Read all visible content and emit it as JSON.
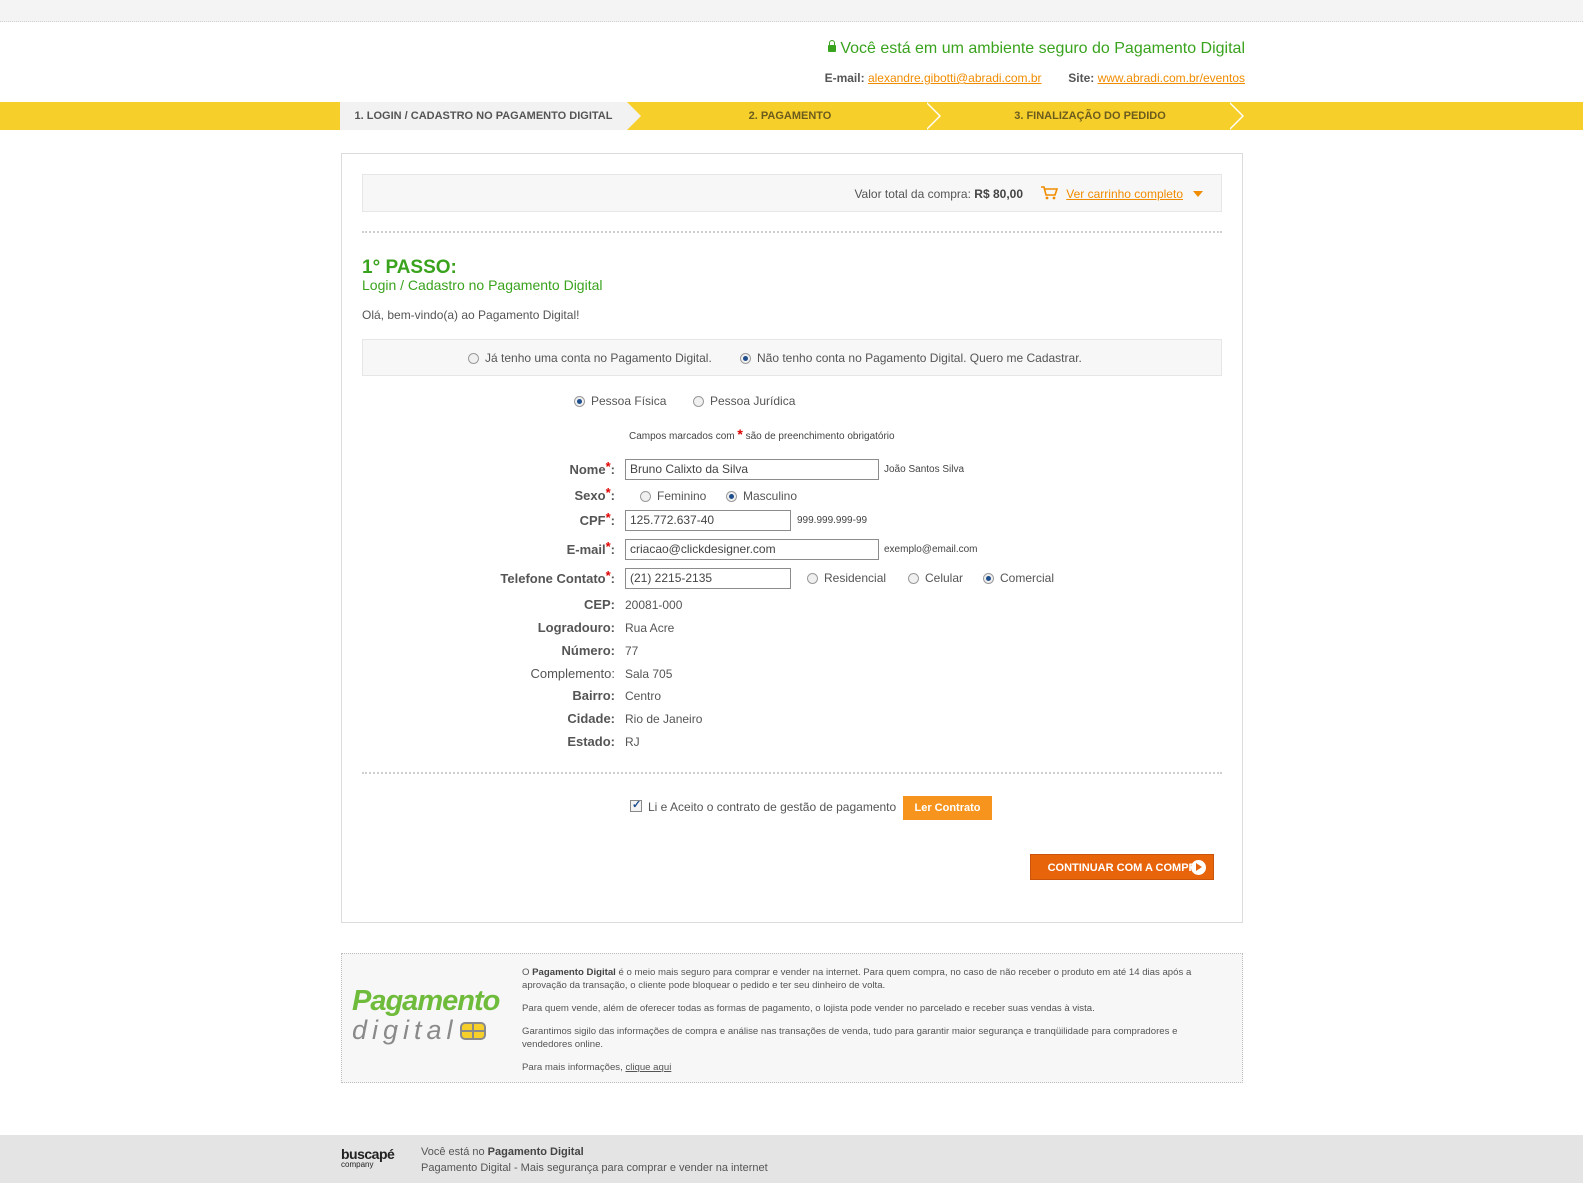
{
  "header": {
    "secure_text": "Você está em um ambiente seguro do Pagamento Digital",
    "email_label": "E-mail:",
    "email_value": "alexandre.gibotti@abradi.com.br",
    "site_label": "Site:",
    "site_value": "www.abradi.com.br/eventos"
  },
  "steps": [
    {
      "label": "1. LOGIN / CADASTRO NO PAGAMENTO DIGITAL"
    },
    {
      "label": "2. PAGAMENTO"
    },
    {
      "label": "3. FINALIZAÇÃO DO PEDIDO"
    }
  ],
  "cart": {
    "total_label": "Valor total da compra:",
    "total_value": "R$ 80,00",
    "link": "Ver carrinho completo"
  },
  "passo": {
    "title": "1° PASSO:",
    "subtitle": "Login / Cadastro no Pagamento Digital",
    "welcome": "Olá, bem-vindo(a) ao Pagamento Digital!"
  },
  "account_options": [
    {
      "label": "Já tenho uma conta no Pagamento Digital.",
      "selected": false
    },
    {
      "label": "Não tenho conta no Pagamento Digital. Quero me Cadastrar.",
      "selected": true
    }
  ],
  "person_type": [
    {
      "label": "Pessoa Física",
      "selected": true
    },
    {
      "label": "Pessoa Jurídica",
      "selected": false
    }
  ],
  "required_note": {
    "before": "Campos marcados com",
    "star": "*",
    "after": "são de preenchimento obrigatório"
  },
  "form": {
    "nome_label": "Nome",
    "nome_value": "Bruno Calixto da Silva",
    "nome_hint": "João Santos Silva",
    "sexo_label": "Sexo",
    "sexo_options": [
      {
        "label": "Feminino",
        "selected": false
      },
      {
        "label": "Masculino",
        "selected": true
      }
    ],
    "cpf_label": "CPF",
    "cpf_value": "125.772.637-40",
    "cpf_hint": "999.999.999-99",
    "email_label": "E-mail",
    "email_value": "criacao@clickdesigner.com",
    "email_hint": "exemplo@email.com",
    "telefone_label": "Telefone Contato",
    "telefone_value": "(21) 2215-2135",
    "telefone_options": [
      {
        "label": "Residencial",
        "selected": false
      },
      {
        "label": "Celular",
        "selected": false
      },
      {
        "label": "Comercial",
        "selected": true
      }
    ],
    "cep_label": "CEP:",
    "cep_value": "20081-000",
    "logradouro_label": "Logradouro:",
    "logradouro_value": "Rua Acre",
    "numero_label": "Número:",
    "numero_value": "77",
    "complemento_label": "Complemento:",
    "complemento_value": "Sala 705",
    "bairro_label": "Bairro:",
    "bairro_value": "Centro",
    "cidade_label": "Cidade:",
    "cidade_value": "Rio de Janeiro",
    "estado_label": "Estado:",
    "estado_value": "RJ",
    "colon": ":",
    "star": "*"
  },
  "contract": {
    "label": "Li e Aceito o contrato de gestão de pagamento",
    "checked": true,
    "button": "Ler Contrato"
  },
  "continue_button": "CONTINUAR COM A COMPRA",
  "info": {
    "logo_line1": "Pagamento",
    "logo_line2": "digital",
    "p1_prefix": "O",
    "p1_brand": "Pagamento Digital",
    "p1_rest": "é o meio mais seguro para comprar e vender na internet. Para quem compra, no caso de não receber o produto em até 14 dias após a aprovação da transação, o cliente pode bloquear o pedido e ter seu dinheiro de volta.",
    "p2": "Para quem vende, além de oferecer todas as formas de pagamento, o lojista pode vender no parcelado e receber suas vendas à vista.",
    "p3": "Garantimos sigilo das informações de compra e análise nas transações de venda, tudo para garantir maior segurança e tranqüilidade para compradores e vendedores online.",
    "p4_prefix": "Para mais informações,",
    "p4_link": "clique aqui"
  },
  "footer": {
    "brand": "buscapé",
    "brand_sub": "company",
    "line1_prefix": "Você está no",
    "line1_brand": "Pagamento Digital",
    "line2": "Pagamento Digital - Mais segurança para comprar e vender na internet"
  },
  "colors": {
    "green": "#3aa31e",
    "yellow": "#f7cf2b",
    "orange": "#f08c00",
    "button_orange": "#e8640a"
  }
}
